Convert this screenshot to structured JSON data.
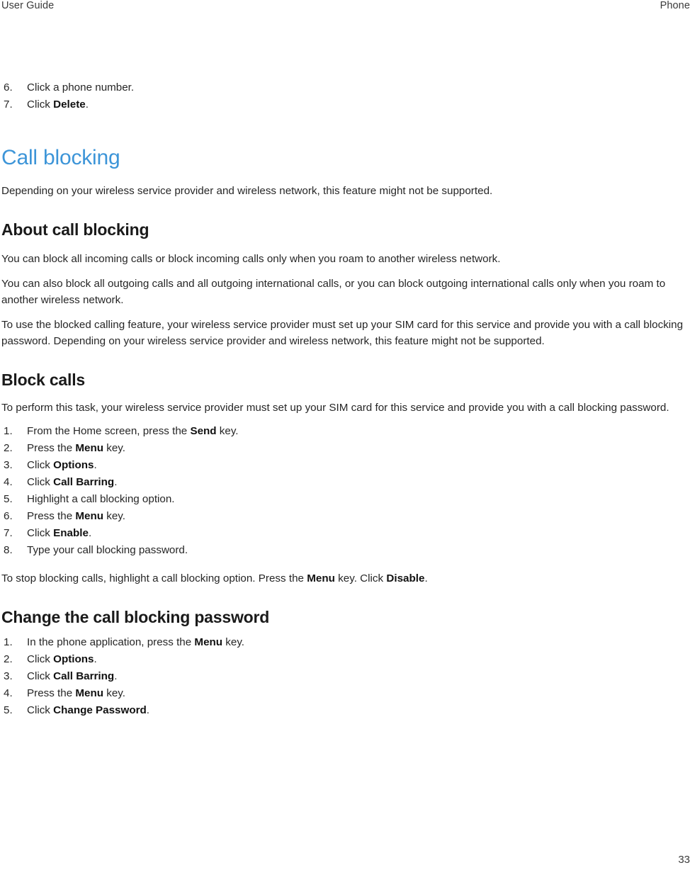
{
  "header": {
    "left": "User Guide",
    "right": "Phone"
  },
  "colors": {
    "section_title": "#3d95d8",
    "body_text": "#262626",
    "header_text": "#3a3a3a"
  },
  "intro_list": {
    "items": [
      {
        "num": "6.",
        "parts": [
          {
            "text": "Click a phone number.",
            "bold": false
          }
        ]
      },
      {
        "num": "7.",
        "parts": [
          {
            "text": "Click ",
            "bold": false
          },
          {
            "text": "Delete",
            "bold": true
          },
          {
            "text": ".",
            "bold": false
          }
        ]
      }
    ]
  },
  "section": {
    "title": "Call blocking",
    "intro": "Depending on your wireless service provider and wireless network, this feature might not be supported."
  },
  "about": {
    "heading": "About call blocking",
    "paragraphs": [
      "You can block all incoming calls or block incoming calls only when you roam to another wireless network.",
      "You can also block all outgoing calls and all outgoing international calls, or you can block outgoing international calls only when you roam to another wireless network.",
      "To use the blocked calling feature, your wireless service provider must set up your SIM card for this service and provide you with a call blocking password. Depending on your wireless service provider and wireless network, this feature might not be supported."
    ]
  },
  "block_calls": {
    "heading": "Block calls",
    "intro": "To perform this task, your wireless service provider must set up your SIM card for this service and provide you with a call blocking password.",
    "steps": [
      {
        "num": "1.",
        "parts": [
          {
            "text": "From the Home screen, press the ",
            "bold": false
          },
          {
            "text": "Send",
            "bold": true
          },
          {
            "text": " key.",
            "bold": false
          }
        ]
      },
      {
        "num": "2.",
        "parts": [
          {
            "text": "Press the ",
            "bold": false
          },
          {
            "text": "Menu",
            "bold": true
          },
          {
            "text": " key.",
            "bold": false
          }
        ]
      },
      {
        "num": "3.",
        "parts": [
          {
            "text": "Click ",
            "bold": false
          },
          {
            "text": "Options",
            "bold": true
          },
          {
            "text": ".",
            "bold": false
          }
        ]
      },
      {
        "num": "4.",
        "parts": [
          {
            "text": "Click ",
            "bold": false
          },
          {
            "text": "Call Barring",
            "bold": true
          },
          {
            "text": ".",
            "bold": false
          }
        ]
      },
      {
        "num": "5.",
        "parts": [
          {
            "text": "Highlight a call blocking option.",
            "bold": false
          }
        ]
      },
      {
        "num": "6.",
        "parts": [
          {
            "text": "Press the ",
            "bold": false
          },
          {
            "text": "Menu",
            "bold": true
          },
          {
            "text": " key.",
            "bold": false
          }
        ]
      },
      {
        "num": "7.",
        "parts": [
          {
            "text": "Click ",
            "bold": false
          },
          {
            "text": "Enable",
            "bold": true
          },
          {
            "text": ".",
            "bold": false
          }
        ]
      },
      {
        "num": "8.",
        "parts": [
          {
            "text": "Type your call blocking password.",
            "bold": false
          }
        ]
      }
    ],
    "outro": [
      {
        "text": "To stop blocking calls, highlight a call blocking option. Press the ",
        "bold": false
      },
      {
        "text": "Menu",
        "bold": true
      },
      {
        "text": " key. Click ",
        "bold": false
      },
      {
        "text": "Disable",
        "bold": true
      },
      {
        "text": ".",
        "bold": false
      }
    ]
  },
  "change_password": {
    "heading": "Change the call blocking password",
    "steps": [
      {
        "num": "1.",
        "parts": [
          {
            "text": "In the phone application, press the ",
            "bold": false
          },
          {
            "text": "Menu",
            "bold": true
          },
          {
            "text": " key.",
            "bold": false
          }
        ]
      },
      {
        "num": "2.",
        "parts": [
          {
            "text": "Click ",
            "bold": false
          },
          {
            "text": "Options",
            "bold": true
          },
          {
            "text": ".",
            "bold": false
          }
        ]
      },
      {
        "num": "3.",
        "parts": [
          {
            "text": "Click ",
            "bold": false
          },
          {
            "text": "Call Barring",
            "bold": true
          },
          {
            "text": ".",
            "bold": false
          }
        ]
      },
      {
        "num": "4.",
        "parts": [
          {
            "text": "Press the ",
            "bold": false
          },
          {
            "text": "Menu",
            "bold": true
          },
          {
            "text": " key.",
            "bold": false
          }
        ]
      },
      {
        "num": "5.",
        "parts": [
          {
            "text": "Click ",
            "bold": false
          },
          {
            "text": "Change Password",
            "bold": true
          },
          {
            "text": ".",
            "bold": false
          }
        ]
      }
    ]
  },
  "footer": {
    "page_number": "33"
  }
}
